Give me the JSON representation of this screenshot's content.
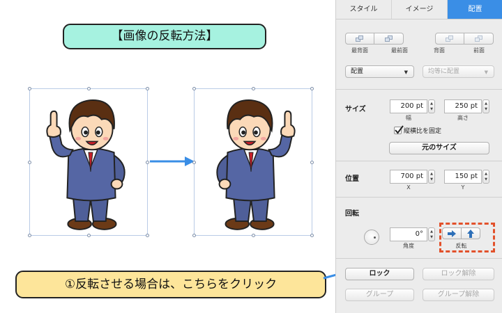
{
  "canvas": {
    "title": "【画像の反転方法】",
    "callout": "①反転させる場合は、こちらをクリック"
  },
  "colors": {
    "title_bg": "#a6f2e0",
    "callout_bg": "#fde59a",
    "accent": "#3a8ee6",
    "highlight": "#e2512b"
  },
  "inspector": {
    "tabs": [
      {
        "label": "スタイル",
        "active": false
      },
      {
        "label": "イメージ",
        "active": false
      },
      {
        "label": "配置",
        "active": true
      }
    ],
    "arrange": {
      "buttons": [
        "最背面",
        "最前面",
        "背面",
        "前面"
      ],
      "align_select": "配置",
      "distribute_select": "均等に配置"
    },
    "size": {
      "label": "サイズ",
      "width": "200 pt",
      "width_label": "幅",
      "height": "250 pt",
      "height_label": "高さ",
      "lock_aspect_label": "縦横比を固定",
      "lock_aspect_checked": true,
      "original_size_label": "元のサイズ"
    },
    "position": {
      "label": "位置",
      "x": "700 pt",
      "x_label": "X",
      "y": "150 pt",
      "y_label": "Y"
    },
    "rotate": {
      "label": "回転",
      "angle": "0°",
      "angle_label": "角度",
      "flip_label": "反転"
    },
    "lock_label": "ロック",
    "unlock_label": "ロック解除",
    "group_label": "グループ",
    "ungroup_label": "グループ解除"
  }
}
